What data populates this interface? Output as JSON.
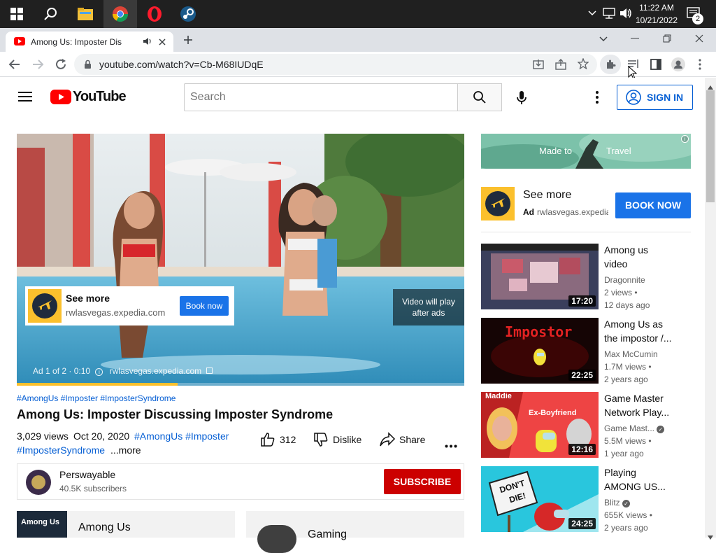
{
  "taskbar": {
    "time": "11:22 AM",
    "date": "10/21/2022",
    "notification_count": "2"
  },
  "browser": {
    "tab_title": "Among Us: Imposter Discuss",
    "url": "youtube.com/watch?v=Cb-M68IUDqE"
  },
  "yt": {
    "logo_text": "YouTube",
    "search_placeholder": "Search",
    "sign_in": "SIGN IN"
  },
  "video_overlay": {
    "ad_title": "See more",
    "ad_domain": "rwlasvegas.expedia.com",
    "ad_button": "Book now",
    "skip_text_1": "Video will play",
    "skip_text_2": "after ads",
    "ad_counter": "Ad 1 of 2 · 0:10",
    "ad_footer_domain": "rwlasvegas.expedia.com",
    "progress_fraction": 0.36
  },
  "video": {
    "hashtags": "#AmongUs #Imposter #ImposterSyndrome",
    "title": "Among Us: Imposter Discussing Imposter Syndrome",
    "views": "3,029 views",
    "date": "Oct 20, 2020",
    "desc_tags_1": "#AmongUs #Imposter",
    "desc_tags_2": "#ImposterSyndrome",
    "more": "...more",
    "likes": "312",
    "dislike": "Dislike",
    "share": "Share"
  },
  "channel": {
    "name": "Perswayable",
    "subscribers": "40.5K subscribers",
    "subscribe": "SUBSCRIBE"
  },
  "chips": {
    "game_name": "Among Us",
    "category": "Gaming"
  },
  "side_ad": {
    "banner_text_1": "Made to",
    "banner_text_2": "Travel",
    "title": "See more",
    "ad_label": "Ad",
    "domain": "rwlasvegas.expedia.com",
    "button": "BOOK NOW"
  },
  "related": [
    {
      "title_1": "Among us",
      "title_2": "video",
      "channel": "Dragonnite",
      "views": "2 views",
      "age": "12 days ago",
      "duration": "17:20"
    },
    {
      "title_1": "Among Us as",
      "title_2": "the impostor /...",
      "channel": "Max McCumin",
      "views": "1.7M views",
      "age": "2 years ago",
      "duration": "22:25",
      "thumb_text": "Impostor"
    },
    {
      "title_1": "Game Master",
      "title_2": "Network Play...",
      "channel": "Game Mast...",
      "views": "5.5M views",
      "age": "1 year ago",
      "duration": "12:16",
      "thumb_text_1": "Maddie",
      "thumb_text_2": "Ex-Boyfriend"
    },
    {
      "title_1": "Playing",
      "title_2": "AMONG US...",
      "channel": "Blitz",
      "views": "655K views",
      "age": "2 years ago",
      "duration": "24:25",
      "thumb_text_1": "DON'T",
      "thumb_text_2": "DIE!"
    }
  ]
}
